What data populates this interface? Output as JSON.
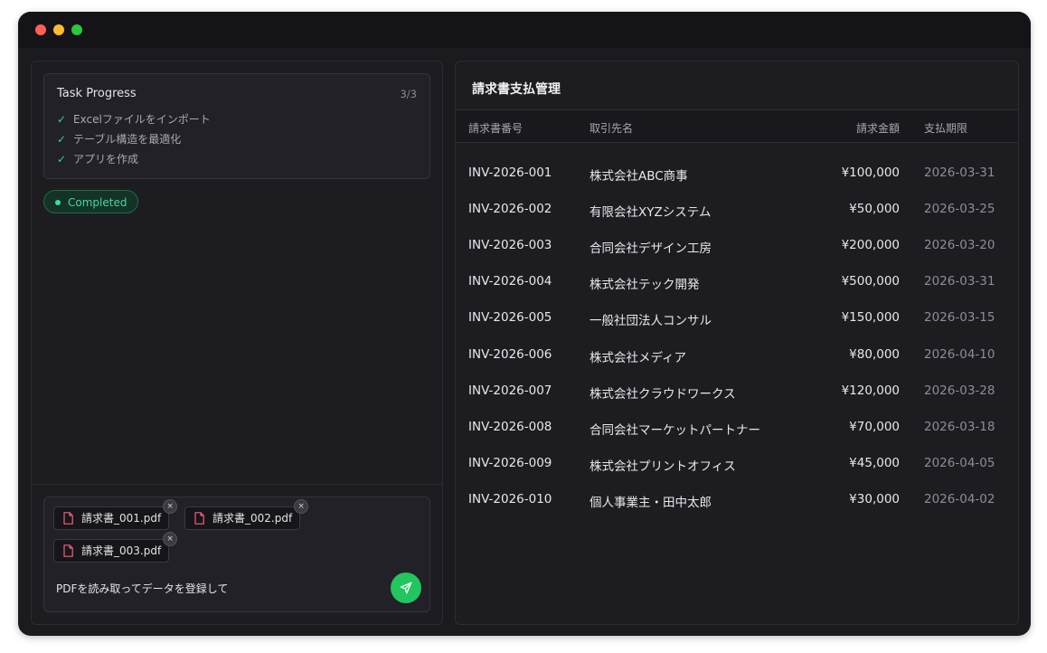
{
  "window": {
    "traffic_lights": [
      "close",
      "minimize",
      "maximize"
    ]
  },
  "task_progress": {
    "title": "Task Progress",
    "count": "3/3",
    "items": [
      {
        "label": "Excelファイルをインポート",
        "done": true
      },
      {
        "label": "テーブル構造を最適化",
        "done": true
      },
      {
        "label": "アプリを作成",
        "done": true
      }
    ],
    "check_glyph": "✓"
  },
  "status": {
    "label": "Completed",
    "color": "#45d79a"
  },
  "composer": {
    "attachments": [
      {
        "name": "請求書_001.pdf"
      },
      {
        "name": "請求書_002.pdf"
      },
      {
        "name": "請求書_003.pdf"
      }
    ],
    "close_glyph": "×",
    "message": "PDFを読み取ってデータを登録して",
    "send_color": "#22c55e"
  },
  "invoice_panel": {
    "title": "請求書支払管理",
    "columns": [
      "請求書番号",
      "取引先名",
      "請求金額",
      "支払期限"
    ],
    "rows": [
      [
        "INV-2026-001",
        "株式会社ABC商事",
        "¥100,000",
        "2026-03-31"
      ],
      [
        "INV-2026-002",
        "有限会社XYZシステム",
        "¥50,000",
        "2026-03-25"
      ],
      [
        "INV-2026-003",
        "合同会社デザイン工房",
        "¥200,000",
        "2026-03-20"
      ],
      [
        "INV-2026-004",
        "株式会社テック開発",
        "¥500,000",
        "2026-03-31"
      ],
      [
        "INV-2026-005",
        "一般社団法人コンサル",
        "¥150,000",
        "2026-03-15"
      ],
      [
        "INV-2026-006",
        "株式会社メディア",
        "¥80,000",
        "2026-04-10"
      ],
      [
        "INV-2026-007",
        "株式会社クラウドワークス",
        "¥120,000",
        "2026-03-28"
      ],
      [
        "INV-2026-008",
        "合同会社マーケットパートナー",
        "¥70,000",
        "2026-03-18"
      ],
      [
        "INV-2026-009",
        "株式会社プリントオフィス",
        "¥45,000",
        "2026-04-05"
      ],
      [
        "INV-2026-010",
        "個人事業主・田中太郎",
        "¥30,000",
        "2026-04-02"
      ]
    ]
  }
}
